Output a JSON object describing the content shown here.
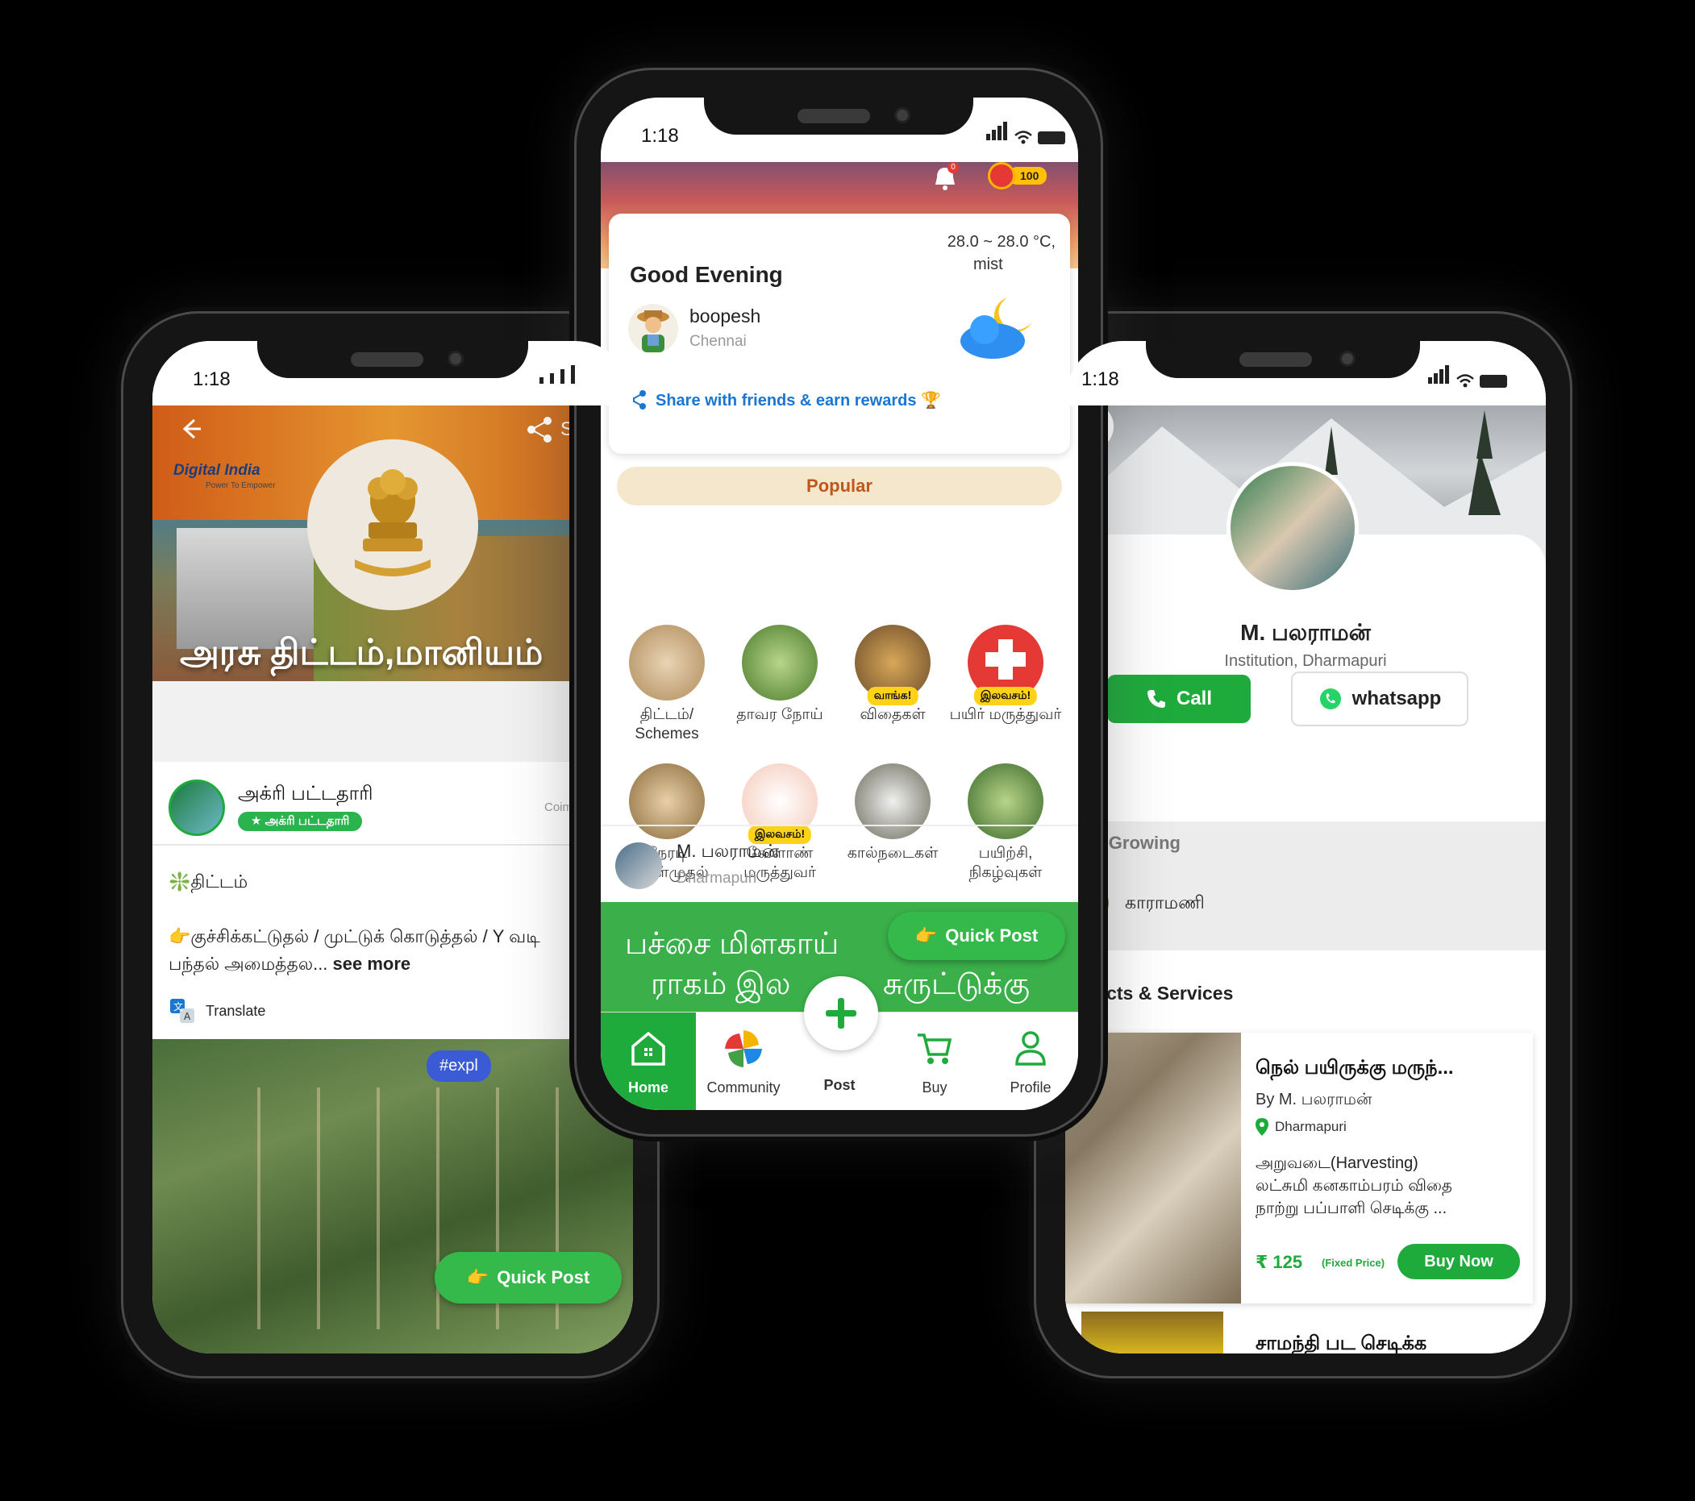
{
  "left_phone": {
    "time": "1:18",
    "banner_title": "அரசு திட்டம்,மானியம்",
    "banner_logo_text": "Digital India",
    "banner_logo_sub": "Power To Empower",
    "share_label": "S",
    "author_name": "அக்ரி பட்டதாரி",
    "author_badge": "★ அக்ரி பட்டதாரி",
    "author_location": "Coim",
    "post_heading": "❇️திட்டம்",
    "post_body": "👉குச்சிக்கட்டுதல் / முட்டுக் கொடுத்தல் / Y வடி",
    "post_body_2": "பந்தல் அமைத்தல...",
    "see_more": " see more",
    "translate_label": "Translate",
    "hashtag": "#expl",
    "quick_post": "Quick Post"
  },
  "center_phone": {
    "time": "1:18",
    "notification_count": "0",
    "reward_points": "100",
    "greeting": "Good Evening",
    "weather_temp": "28.0 ~ 28.0 °C,",
    "weather_desc": "mist",
    "user_name": "boopesh",
    "user_city": "Chennai",
    "share_text": "Share with friends & earn rewards 🏆",
    "popular_label": "Popular",
    "tiles": [
      {
        "label": "திட்டம்/ Schemes",
        "tag": ""
      },
      {
        "label": "தாவர நோய்",
        "tag": ""
      },
      {
        "label": "விதைகள்",
        "tag": "வாங்க!"
      },
      {
        "label": "பயிர் மருத்துவர்",
        "tag": "இலவசம்!"
      },
      {
        "label": "நேரடி கொள்முதல்",
        "tag": ""
      },
      {
        "label": "வேளாண் மருத்துவர்",
        "tag": "இலவசம்!"
      },
      {
        "label": "கால்நடைகள்",
        "tag": ""
      },
      {
        "label": "பயிற்சி, நிகழ்வுகள்",
        "tag": ""
      }
    ],
    "feed_author": "M. பலராமன்",
    "feed_location": "Dharmapuri",
    "green_line_1": "பச்சை மிளகாய்",
    "green_line_2": "ராகம் இல",
    "green_line_3": "சுருட்டுக்கு",
    "quick_post": "Quick Post",
    "nav": [
      {
        "label": "Home"
      },
      {
        "label": "Community"
      },
      {
        "label": "Post"
      },
      {
        "label": "Buy"
      },
      {
        "label": "Profile"
      }
    ]
  },
  "right_phone": {
    "time": "1:18",
    "profile_name": "M. பலராமன்",
    "profile_sub": "Institution, Dharmapuri",
    "call_label": "Call",
    "whatsapp_label": "whatsapp",
    "crops_heading": "rops Growing",
    "crop_name": "காராமணி",
    "products_heading": "roducts & Services",
    "product_title": "நெல் பயிருக்கு மருந்...",
    "product_by": "By M. பலராமன்",
    "product_location": "Dharmapuri",
    "product_desc_1": "அறுவடை(Harvesting)",
    "product_desc_2": "லட்சுமி கனகாம்பரம் விதை",
    "product_desc_3": "நாற்று பப்பாளி செடிக்கு ...",
    "product_price": "₹ 125",
    "price_note": "(Fixed Price)",
    "buy_now": "Buy Now",
    "next_product_title": "சாமந்தி பட செடிக்க"
  },
  "colors": {
    "brand_green": "#1fab3c",
    "popular_text": "#c0561c",
    "link_blue": "#1976d2"
  }
}
